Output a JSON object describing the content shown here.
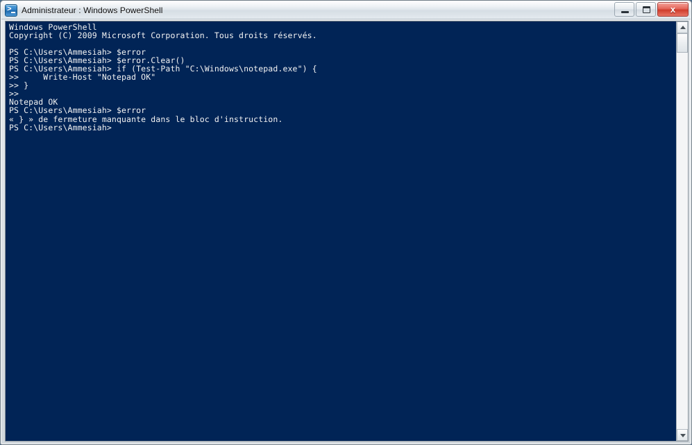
{
  "window": {
    "title": "Administrateur : Windows PowerShell",
    "icon": "powershell-icon",
    "background_color": "#012456",
    "text_color": "#f2f2f2",
    "buttons": {
      "minimize": "minimize-icon",
      "maximize": "maximize-icon",
      "close_label": "x"
    }
  },
  "console": {
    "lines": [
      "Windows PowerShell",
      "Copyright (C) 2009 Microsoft Corporation. Tous droits réservés.",
      "",
      "PS C:\\Users\\Ammesiah> $error",
      "PS C:\\Users\\Ammesiah> $error.Clear()",
      "PS C:\\Users\\Ammesiah> if (Test-Path \"C:\\Windows\\notepad.exe\") {",
      ">>     Write-Host \"Notepad OK\"",
      ">> }",
      ">>",
      "Notepad OK",
      "PS C:\\Users\\Ammesiah> $error",
      "« } » de fermeture manquante dans le bloc d'instruction.",
      "PS C:\\Users\\Ammesiah>"
    ],
    "text": "Windows PowerShell\nCopyright (C) 2009 Microsoft Corporation. Tous droits réservés.\n\nPS C:\\Users\\Ammesiah> $error\nPS C:\\Users\\Ammesiah> $error.Clear()\nPS C:\\Users\\Ammesiah> if (Test-Path \"C:\\Windows\\notepad.exe\") {\n>>     Write-Host \"Notepad OK\"\n>> }\n>>\nNotepad OK\nPS C:\\Users\\Ammesiah> $error\n« } » de fermeture manquante dans le bloc d'instruction.\nPS C:\\Users\\Ammesiah>"
  },
  "scrollbar": {
    "up_arrow": "scroll-up-icon",
    "down_arrow": "scroll-down-icon"
  }
}
